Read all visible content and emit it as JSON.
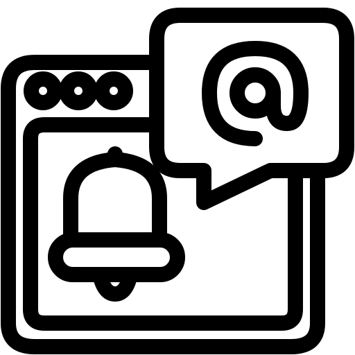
{
  "icon": {
    "name": "browser-notification-email-icon",
    "stroke_color": "#000000",
    "fill_color": "#ffffff",
    "parts": {
      "window": "browser-window-icon",
      "dots": "window-control-dots-icon",
      "bell": "bell-icon",
      "bubble": "speech-bubble-icon",
      "at": "at-sign-icon"
    }
  }
}
